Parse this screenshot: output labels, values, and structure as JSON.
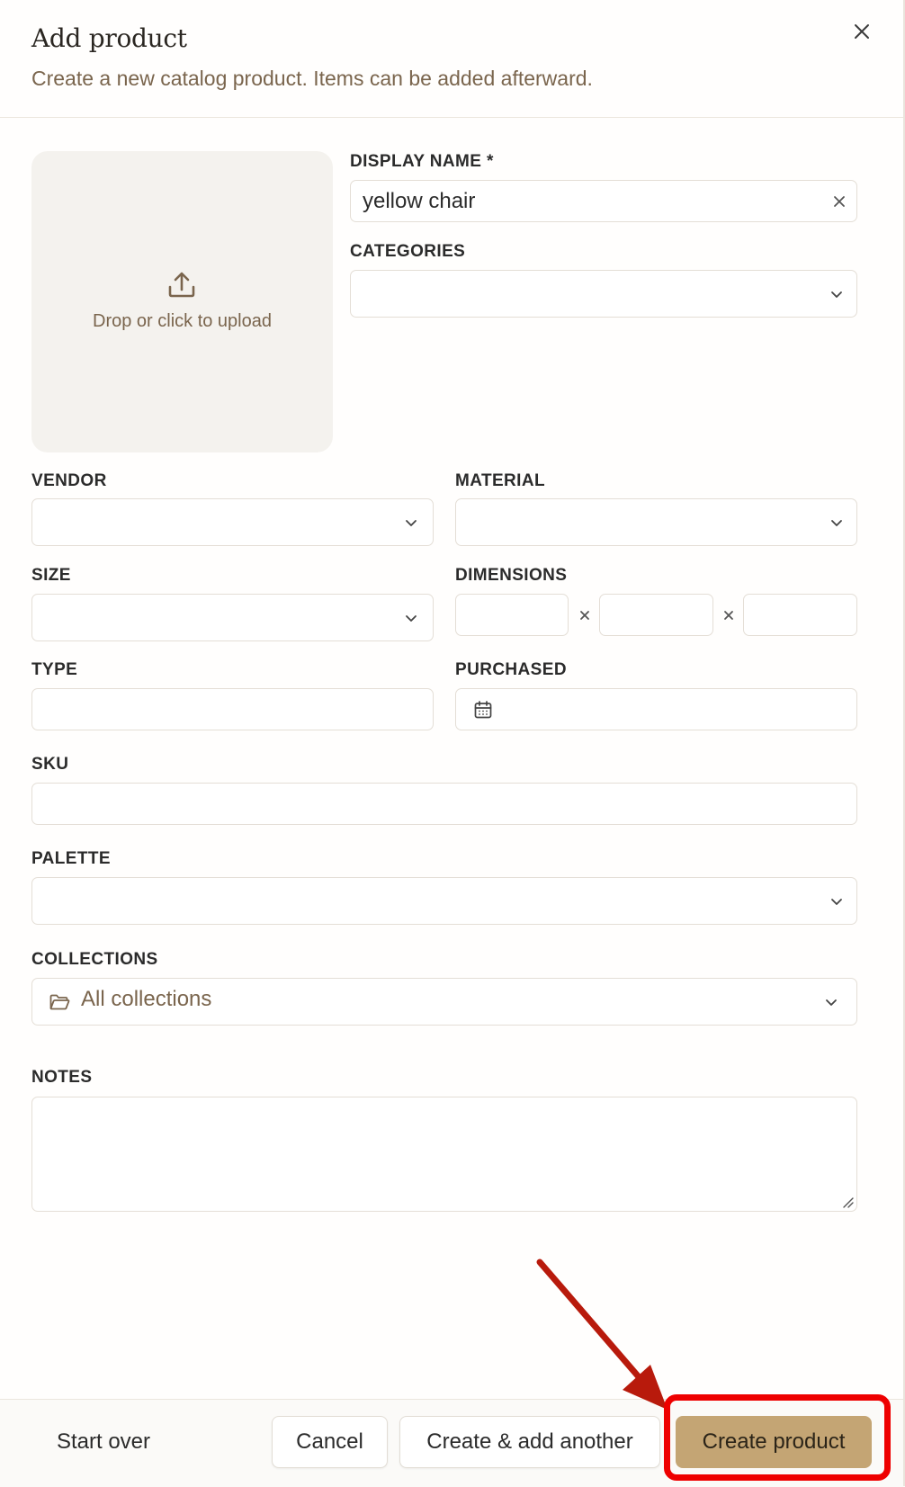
{
  "header": {
    "title": "Add product",
    "subtitle": "Create a new catalog product. Items can be added afterward."
  },
  "upload": {
    "label": "Drop or click to upload"
  },
  "fields": {
    "display_name": {
      "label": "DISPLAY NAME *",
      "value": "yellow chair"
    },
    "categories": {
      "label": "CATEGORIES",
      "value": ""
    },
    "vendor": {
      "label": "VENDOR",
      "value": ""
    },
    "material": {
      "label": "MATERIAL",
      "value": ""
    },
    "size": {
      "label": "SIZE",
      "value": ""
    },
    "dimensions": {
      "label": "DIMENSIONS",
      "values": [
        "",
        "",
        ""
      ]
    },
    "type": {
      "label": "TYPE",
      "value": ""
    },
    "purchased": {
      "label": "PURCHASED",
      "value": ""
    },
    "sku": {
      "label": "SKU",
      "value": ""
    },
    "palette": {
      "label": "PALETTE",
      "value": ""
    },
    "collections": {
      "label": "COLLECTIONS",
      "value": "All collections"
    },
    "notes": {
      "label": "NOTES",
      "value": ""
    }
  },
  "footer": {
    "start_over": "Start over",
    "cancel": "Cancel",
    "create_add_another": "Create & add another",
    "create_product": "Create product"
  },
  "colors": {
    "accent": "#c4a574",
    "muted_text": "#7a654d",
    "annotation": "#ee0000"
  },
  "icons": [
    "close-icon",
    "upload-icon",
    "chevron-down-icon",
    "calendar-icon",
    "folder-icon",
    "resize-grip-icon"
  ]
}
